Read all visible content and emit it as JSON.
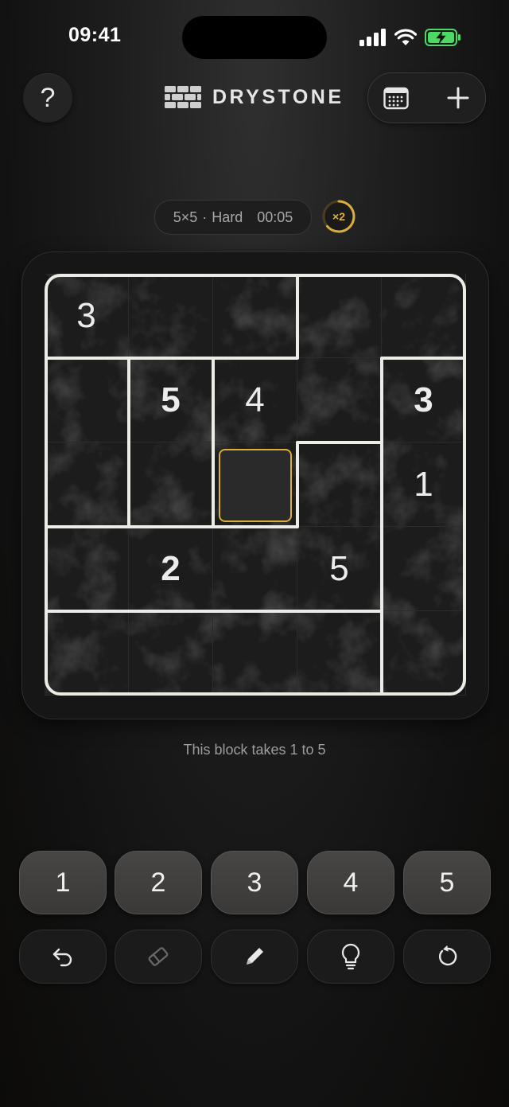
{
  "status_bar": {
    "time": "09:41"
  },
  "header": {
    "help_label": "?",
    "app_name": "DRYSTONE",
    "icons": {
      "calendar": "calendar-icon",
      "add": "plus-icon",
      "logo": "stone-wall-icon"
    }
  },
  "game_info": {
    "size": "5×5",
    "separator": "·",
    "difficulty": "Hard",
    "timer": "00:05",
    "multiplier": "×2"
  },
  "board": {
    "rows": 5,
    "cols": 5,
    "cells": [
      [
        "3",
        "",
        "",
        "",
        ""
      ],
      [
        "",
        "5",
        "4",
        "",
        "3"
      ],
      [
        "",
        "",
        "",
        "",
        "1"
      ],
      [
        "",
        "2",
        "",
        "5",
        ""
      ],
      [
        "",
        "",
        "",
        "",
        ""
      ]
    ],
    "given_style": [
      [
        false,
        false,
        false,
        false,
        false
      ],
      [
        false,
        true,
        false,
        false,
        true
      ],
      [
        false,
        false,
        false,
        false,
        false
      ],
      [
        false,
        true,
        false,
        false,
        false
      ],
      [
        false,
        false,
        false,
        false,
        false
      ]
    ],
    "selected": [
      2,
      2
    ]
  },
  "hint": "This block takes 1 to 5",
  "keypad": [
    "1",
    "2",
    "3",
    "4",
    "5"
  ],
  "tools": [
    "undo-icon",
    "eraser-icon",
    "pencil-icon",
    "lightbulb-icon",
    "restart-icon"
  ],
  "colors": {
    "accent": "#d9ae3c",
    "wall": "#ecebe6",
    "battery": "#4cd964"
  }
}
